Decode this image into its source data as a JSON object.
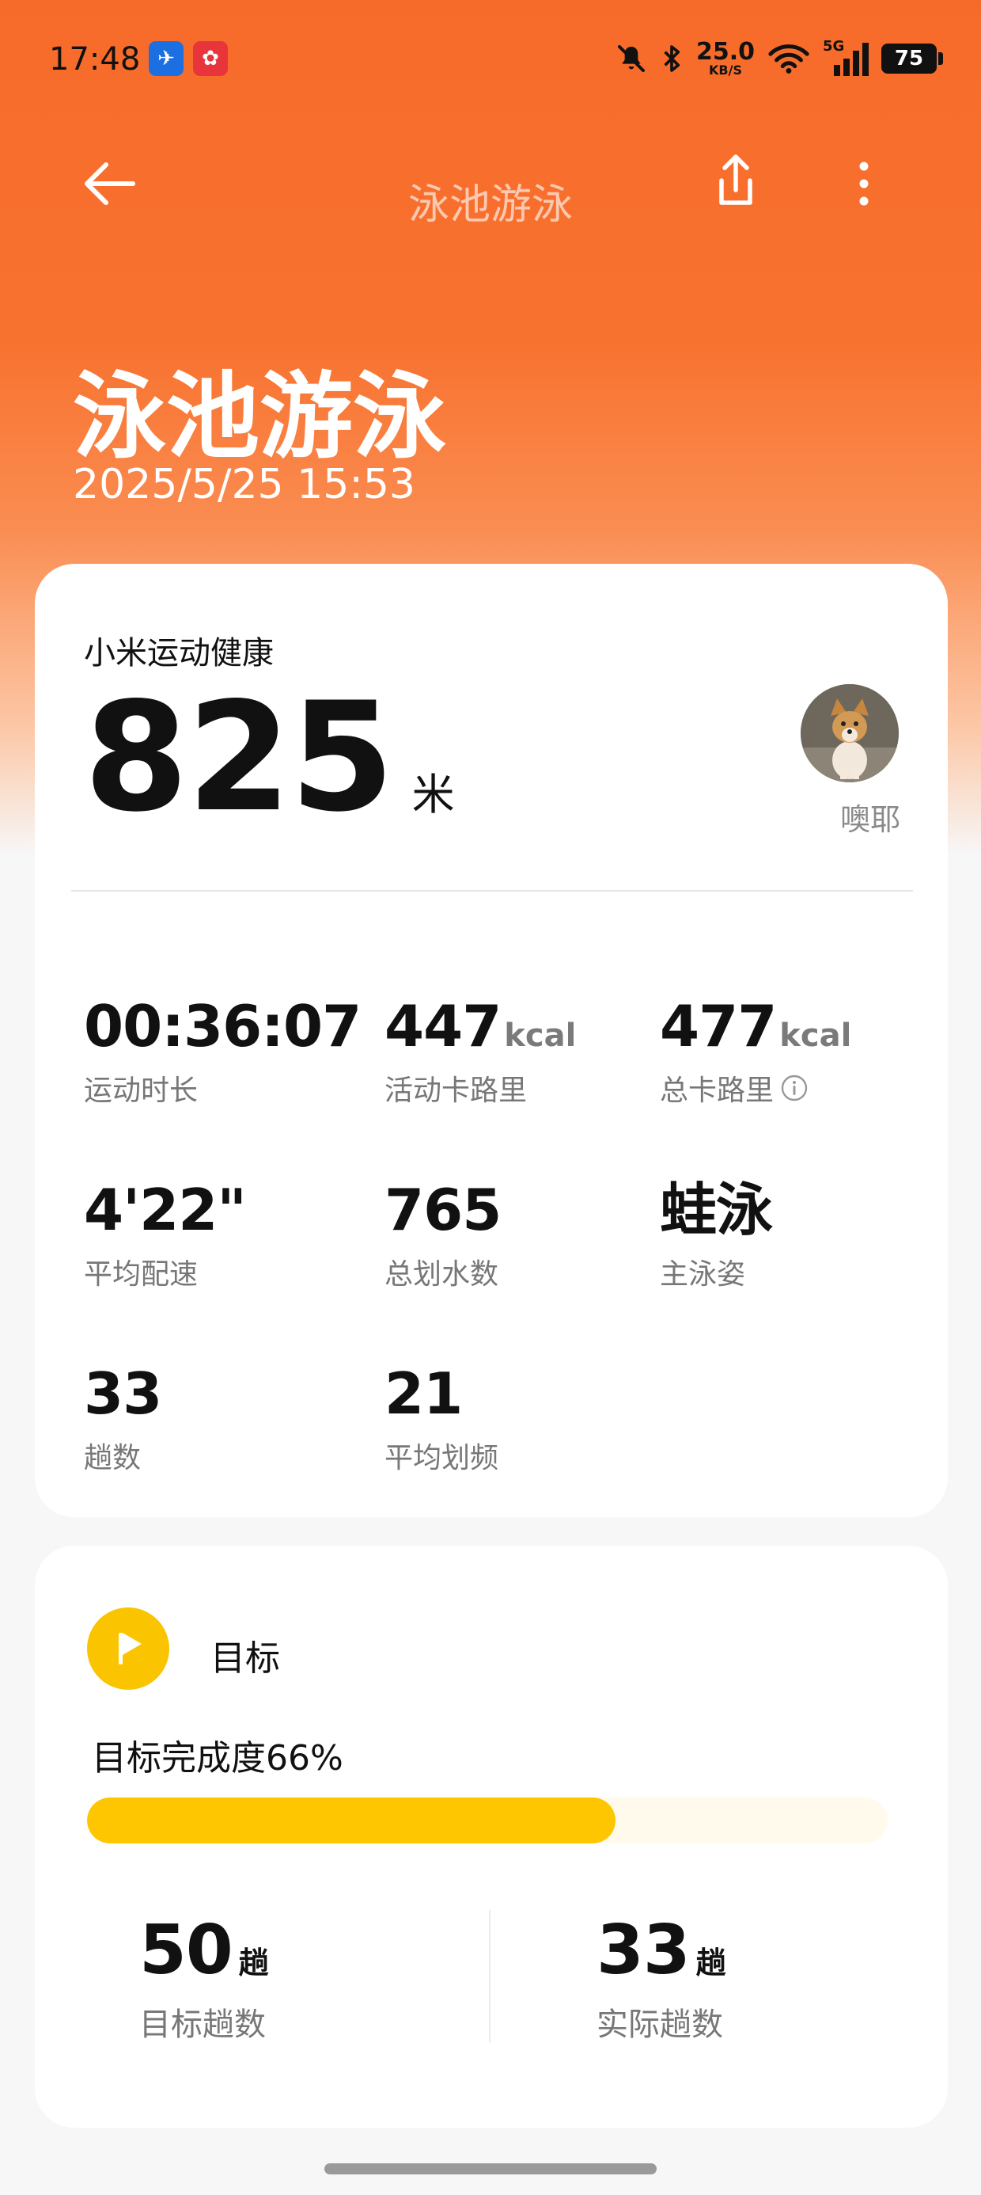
{
  "status_bar": {
    "time": "17:48",
    "notification_icons": [
      "fish-app-icon",
      "red-flower-app-icon"
    ],
    "net_speed_value": "25.0",
    "net_speed_unit": "KB/S",
    "network_label": "5G",
    "battery": "75"
  },
  "top_bar": {
    "title": "泳池游泳",
    "icons": [
      "back-arrow-icon",
      "share-icon",
      "more-vertical-icon"
    ]
  },
  "hero": {
    "title": "泳池游泳",
    "datetime": "2025/5/25 15:53",
    "background_color": "#f76b2a"
  },
  "summary": {
    "source_app": "小米运动健康",
    "distance_value": "825",
    "distance_unit": "米",
    "user_name": "噢耶",
    "stats": [
      {
        "value": "00:36:07",
        "unit": "",
        "label": "运动时长"
      },
      {
        "value": "447",
        "unit": "kcal",
        "label": "活动卡路里"
      },
      {
        "value": "477",
        "unit": "kcal",
        "label": "总卡路里",
        "has_info_icon": true
      },
      {
        "value": "4'22\"",
        "unit": "",
        "label": "平均配速"
      },
      {
        "value": "765",
        "unit": "",
        "label": "总划水数"
      },
      {
        "value": "蛙泳",
        "unit": "",
        "label": "主泳姿"
      },
      {
        "value": "33",
        "unit": "",
        "label": "趟数"
      },
      {
        "value": "21",
        "unit": "",
        "label": "平均划频"
      }
    ]
  },
  "goal": {
    "title": "目标",
    "progress_label": "目标完成度66%",
    "progress_fraction": 0.66,
    "accent_color": "#fdc600",
    "target": {
      "value": "50",
      "unit": "趟",
      "label": "目标趟数"
    },
    "actual": {
      "value": "33",
      "unit": "趟",
      "label": "实际趟数"
    }
  }
}
